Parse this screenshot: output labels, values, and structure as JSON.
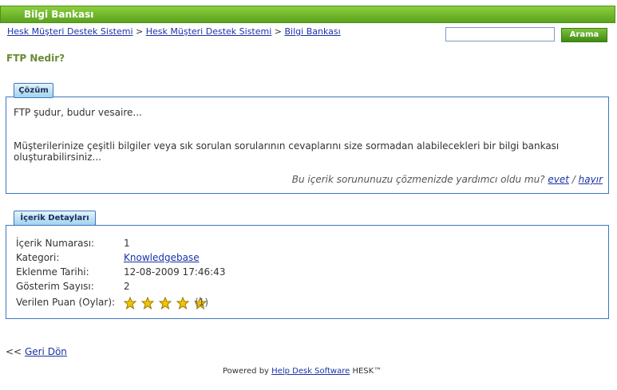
{
  "header": {
    "title": "Bilgi Bankası"
  },
  "breadcrumb": {
    "items": [
      "Hesk Müşteri Destek Sistemi",
      "Hesk Müşteri Destek Sistemi",
      "Bilgi Bankası"
    ],
    "separator": ">"
  },
  "search": {
    "value": "",
    "button_label": "Arama"
  },
  "article": {
    "title": "FTP Nedir?",
    "solution_tab": "Çözüm",
    "line1": "FTP şudur, budur vesaire...",
    "line2a": "Müşterilerinize çeşitli bilgiler veya sık sorulan sorularının cevaplarını size sormadan alabilecekleri bir bilgi bankası",
    "line2b": "oluşturabilirsiniz...",
    "helpful_question": "Bu içerik sorununuzu çözmenizde yardımcı oldu mu?",
    "yes": "evet",
    "slash": "/",
    "no": "hayır"
  },
  "details": {
    "tab": "İçerik Detayları",
    "rows": [
      {
        "label": "İçerik Numarası:",
        "value": "1"
      },
      {
        "label": "Kategori:",
        "value": "Knowledgebase"
      },
      {
        "label": "Eklenme Tarihi:",
        "value": "12-08-2009 17:46:43"
      },
      {
        "label": "Gösterim Sayısı:",
        "value": "2"
      },
      {
        "label": "Verilen Puan (Oylar):",
        "value": "(1)"
      }
    ],
    "rating": {
      "stars": 5,
      "max": 5,
      "icon": "star-icon"
    }
  },
  "back": {
    "prefix": "<<",
    "label": "Geri Dön"
  },
  "footer": {
    "prefix": "Powered by",
    "link": "Help Desk Software",
    "suffix": "HESK™"
  },
  "colors": {
    "header_green": "#5aa21e",
    "border_blue": "#3e76c2",
    "link": "#1a33a6",
    "title_green": "#6b8a33"
  }
}
